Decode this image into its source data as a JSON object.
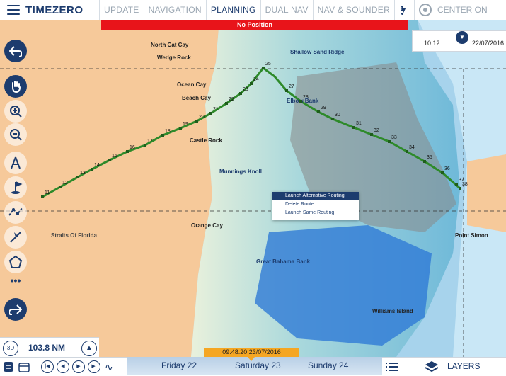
{
  "app": {
    "logo_text": "TIMEZERO"
  },
  "tabs": [
    {
      "label": "UPDATE",
      "active": false
    },
    {
      "label": "NAVIGATION",
      "active": false
    },
    {
      "label": "PLANNING",
      "active": true
    },
    {
      "label": "DUAL NAV",
      "active": false
    },
    {
      "label": "NAV & SOUNDER",
      "active": false
    }
  ],
  "topbar": {
    "center_label": "CENTER ON"
  },
  "banner": {
    "text": "No Position"
  },
  "time_panel": {
    "time": "10:12",
    "date": "22/07/2016"
  },
  "context_menu": {
    "items": [
      "Launch Alternative Routing",
      "Delete Route",
      "Launch Same Routing"
    ],
    "selected": 0
  },
  "map": {
    "places": [
      "North Cat Cay",
      "Wedge Rock",
      "Shallow Sand Ridge",
      "Ocean Cay",
      "Beach Cay",
      "Elbow Bank",
      "Castle Rock",
      "Munnings Knoll",
      "Straits Of Florida",
      "Orange Cay",
      "Great Bahama Bank",
      "Point Simon",
      "Williams Island"
    ],
    "route_waypoints": [
      "11",
      "12",
      "13",
      "14",
      "15",
      "16",
      "17",
      "18",
      "19",
      "20",
      "21",
      "22",
      "23",
      "24",
      "25",
      "27",
      "28",
      "29",
      "30",
      "31",
      "32",
      "33",
      "34",
      "35",
      "36",
      "37",
      "38"
    ]
  },
  "bottom": {
    "btn3d": "3D",
    "distance": "103.8 NM",
    "time_tag": "09:48:20 23/07/2016",
    "days": [
      "Friday 22",
      "Saturday 23",
      "Sunday 24"
    ],
    "layers_label": "LAYERS"
  },
  "colors": {
    "brand": "#1d3c6e",
    "banner": "#e8141a",
    "route": "#2e8a2a",
    "land": "#f6c99a",
    "time_tag": "#f5a623"
  }
}
